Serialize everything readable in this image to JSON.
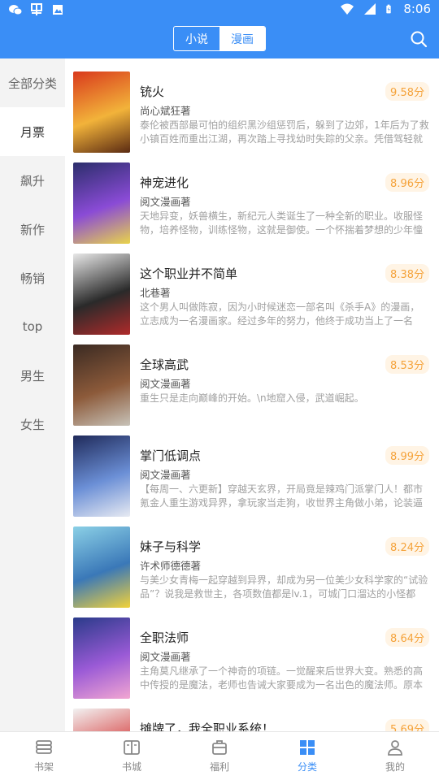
{
  "status_bar": {
    "time": "8:06",
    "left_icons": [
      "wechat-icon",
      "app-icon",
      "image-icon"
    ],
    "right_icons": [
      "wifi-icon",
      "signal-icon",
      "battery-icon"
    ]
  },
  "header": {
    "tabs": [
      {
        "label": "小说",
        "active": false
      },
      {
        "label": "漫画",
        "active": true
      }
    ],
    "search_icon": "search-icon"
  },
  "sidebar": {
    "items": [
      {
        "label": "全部分类",
        "selected": false
      },
      {
        "label": "月票",
        "selected": true
      },
      {
        "label": "飙升",
        "selected": false
      },
      {
        "label": "新作",
        "selected": false
      },
      {
        "label": "畅销",
        "selected": false
      },
      {
        "label": "top",
        "selected": false
      },
      {
        "label": "男生",
        "selected": false
      },
      {
        "label": "女生",
        "selected": false
      }
    ]
  },
  "books": [
    {
      "title": "铳火",
      "score": "9.58分",
      "author": "尚心斌狂著",
      "desc": "泰伦被西部最可怕的组织黑沙组惩罚后，躲到了边郊，1年后为了救小镇百姓而重出江湖，再次踏上寻找幼时失踪的父亲。凭借驾轻就熟的枪法……",
      "colors": [
        "#d9391c",
        "#f2b33a",
        "#5a2a12"
      ]
    },
    {
      "title": "神宠进化",
      "score": "8.96分",
      "author": "阅文漫画著",
      "desc": "天地异变，妖兽横生，新纪元人类诞生了一种全新的职业。收服怪物，培养怪物，训练怪物，这就是御使。一个怀揣着梦想的少年憧憬成为最强……",
      "colors": [
        "#2b2e6b",
        "#8a4bd6",
        "#e9d44a"
      ]
    },
    {
      "title": "这个职业并不简单",
      "score": "8.38分",
      "author": "北巷著",
      "desc": "这个男人叫做陈寂，因为小时候迷恋一部名叫《杀手A》的漫画，立志成为一名漫画家。经过多年的努力，他终于成功当上了一名——",
      "colors": [
        "#e8e8e8",
        "#2a2a2a",
        "#b02a2a"
      ]
    },
    {
      "title": "全球高武",
      "score": "8.53分",
      "author": "阅文漫画著",
      "desc": "重生只是走向巅峰的开始。\\n地窟入侵，武道崛起。",
      "colors": [
        "#3a2a22",
        "#8c5a3a",
        "#c7c2b8"
      ]
    },
    {
      "title": "掌门低调点",
      "score": "8.99分",
      "author": "阅文漫画著",
      "desc": "【每周一、六更新】穿越天玄界，开局竟是辣鸡门派掌门人！都市氪金人重生游戏异界，拿玩家当走狗，收世界主角做小弟，论装逼谁……",
      "colors": [
        "#1f2a5a",
        "#6b8fd6",
        "#e7eaf2"
      ]
    },
    {
      "title": "妹子与科学",
      "score": "8.24分",
      "author": "许术师德德著",
      "desc": "与美少女青梅一起穿越到异界，却成为另一位美少女科学家的“试验品”？说我是救世主，各项数值都是lv.1，可城门口溜达的小怪都Lv.……",
      "colors": [
        "#8bd0e6",
        "#3a78b8",
        "#f2d23a"
      ]
    },
    {
      "title": "全职法师",
      "score": "8.64分",
      "author": "阅文漫画著",
      "desc": "主角莫凡继承了一个神奇的项链。一觉醒来后世界大变。熟悉的高中传授的是魔法，老师也告诫大家要成为一名出色的魔法师。原本在……",
      "colors": [
        "#2a3b8a",
        "#9a5ad6",
        "#f2a6d2"
      ]
    },
    {
      "title": "摊牌了，我全职业系统！",
      "score": "5.69分",
      "author": "",
      "desc": "",
      "colors": [
        "#f2f2f2",
        "#d84a4a",
        "#3a3a3a"
      ]
    }
  ],
  "bottom_nav": [
    {
      "label": "书架",
      "icon": "bookshelf-icon",
      "active": false
    },
    {
      "label": "书城",
      "icon": "open-book-icon",
      "active": false
    },
    {
      "label": "福利",
      "icon": "gift-icon",
      "active": false
    },
    {
      "label": "分类",
      "icon": "grid-icon",
      "active": true
    },
    {
      "label": "我的",
      "icon": "user-icon",
      "active": false
    }
  ],
  "accent_color": "#3a8ef6",
  "score_color": "#f5a33b"
}
